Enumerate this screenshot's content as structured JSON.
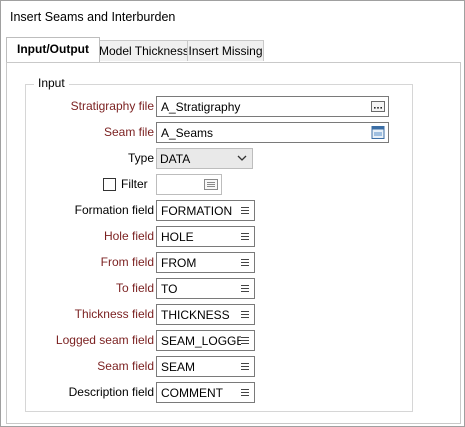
{
  "window": {
    "title": "Insert Seams and Interburden"
  },
  "tabs": [
    {
      "label": "Input/Output",
      "active": true
    },
    {
      "label": "Model Thickness",
      "active": false
    },
    {
      "label": "Insert Missing",
      "active": false
    }
  ],
  "group": {
    "label": "Input"
  },
  "fields": {
    "stratigraphy_file": {
      "label": "Stratigraphy file",
      "value": "A_Stratigraphy"
    },
    "seam_file": {
      "label": "Seam file",
      "value": "A_Seams"
    },
    "type": {
      "label": "Type",
      "value": "DATA"
    },
    "filter": {
      "label": "Filter",
      "checked": false,
      "value": ""
    },
    "formation_field": {
      "label": "Formation field",
      "value": "FORMATION"
    },
    "hole_field": {
      "label": "Hole field",
      "value": "HOLE"
    },
    "from_field": {
      "label": "From field",
      "value": "FROM"
    },
    "to_field": {
      "label": "To field",
      "value": "TO"
    },
    "thickness_field": {
      "label": "Thickness field",
      "value": "THICKNESS"
    },
    "logged_seam_field": {
      "label": "Logged seam field",
      "value": "SEAM_LOGGED"
    },
    "seam_field": {
      "label": "Seam field",
      "value": "SEAM"
    },
    "description_field": {
      "label": "Description field",
      "value": "COMMENT"
    }
  },
  "colors": {
    "required_label": "#7a1f1f",
    "tab_border": "#c9c9c9",
    "field_border": "#7a7a7a"
  },
  "icons": {
    "file_browse": "ellipsis-browse-icon",
    "file_picker": "file-picker-icon",
    "combo": "chevron-down-icon",
    "list": "list-menu-icon",
    "filter": "filter-builder-icon"
  }
}
